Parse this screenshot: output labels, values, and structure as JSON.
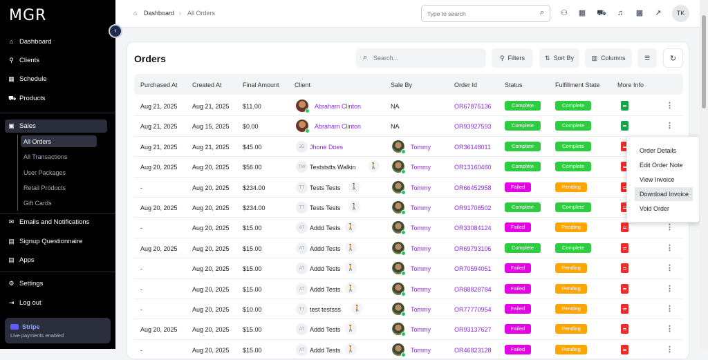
{
  "sidebar": {
    "logo": "MGR",
    "items": [
      {
        "label": "Dashboard",
        "icon": "home-icon"
      },
      {
        "label": "Clients",
        "icon": "user-icon"
      },
      {
        "label": "Schedule",
        "icon": "calendar-icon"
      },
      {
        "label": "Products",
        "icon": "cart-icon"
      },
      {
        "label": "Sales",
        "icon": "box-icon"
      },
      {
        "label": "Emails and Notifications",
        "icon": "mail-icon"
      },
      {
        "label": "Signup Questionnaire",
        "icon": "book-icon"
      },
      {
        "label": "Apps",
        "icon": "book-icon"
      },
      {
        "label": "Settings",
        "icon": "gear-icon"
      },
      {
        "label": "Log out",
        "icon": "logout-icon"
      }
    ],
    "sales_sub": [
      "All Orders",
      "All Transactions",
      "User Packages",
      "Retail Products",
      "Gift Cards"
    ],
    "stripe": {
      "title": "Stripe",
      "subtitle": "Live payments enabled"
    }
  },
  "header": {
    "breadcrumb_home": "Dashboard",
    "breadcrumb_current": "All Orders",
    "search_placeholder": "Type to search",
    "avatar": "TK"
  },
  "orders": {
    "title": "Orders",
    "search_placeholder": "Search...",
    "filters_label": "Filters",
    "sort_label": "Sort By",
    "columns_label": "Columns",
    "headers": [
      "Purchased At",
      "Created At",
      "Final Amount",
      "Client",
      "Sale By",
      "Order Id",
      "Status",
      "Fulfillment State",
      "More Info"
    ],
    "rows": [
      {
        "purchased": "Aug 21, 2025",
        "created": "Aug 21, 2025",
        "amount": "$11.00",
        "client": "Abraham Clinton",
        "client_type": "photo",
        "sale_by": "NA",
        "order_id": "OR67875136",
        "status": "Complete",
        "fulfill": "Complete",
        "doc": "green"
      },
      {
        "purchased": "Aug 21, 2025",
        "created": "Aug 15, 2025",
        "amount": "$0.00",
        "client": "Abraham Clinton",
        "client_type": "photo",
        "sale_by": "NA",
        "order_id": "OR93927593",
        "status": "Complete",
        "fulfill": "Complete",
        "doc": "green"
      },
      {
        "purchased": "Aug 21, 2025",
        "created": "Aug 21, 2025",
        "amount": "$45.00",
        "client": "Jhone Does",
        "client_type": "initials",
        "initials": "JD",
        "sale_by": "Tommy",
        "order_id": "OR36148011",
        "status": "Complete",
        "fulfill": "Complete",
        "doc": "red"
      },
      {
        "purchased": "Aug 20, 2025",
        "created": "Aug 20, 2025",
        "amount": "$56.00",
        "client": "Testststts Walkin",
        "client_type": "initials",
        "initials": "TW",
        "walkin": true,
        "sale_by": "Tommy",
        "order_id": "OR13160460",
        "status": "Complete",
        "fulfill": "Complete",
        "doc": "red"
      },
      {
        "purchased": "-",
        "created": "Aug 20, 2025",
        "amount": "$234.00",
        "client": "Tests Tests",
        "client_type": "initials",
        "initials": "TT",
        "walkin": true,
        "sale_by": "Tommy",
        "order_id": "OR66452958",
        "status": "Failed",
        "fulfill": "Pending",
        "doc": "red"
      },
      {
        "purchased": "Aug 20, 2025",
        "created": "Aug 20, 2025",
        "amount": "$234.00",
        "client": "Tests Tests",
        "client_type": "initials",
        "initials": "TT",
        "walkin": true,
        "sale_by": "Tommy",
        "order_id": "OR91706502",
        "status": "Complete",
        "fulfill": "Complete",
        "doc": "red"
      },
      {
        "purchased": "-",
        "created": "Aug 20, 2025",
        "amount": "$15.00",
        "client": "Addd Tests",
        "client_type": "initials",
        "initials": "AT",
        "walkin": true,
        "sale_by": "Tommy",
        "order_id": "OR33084124",
        "status": "Failed",
        "fulfill": "Pending",
        "doc": "red"
      },
      {
        "purchased": "Aug 20, 2025",
        "created": "Aug 20, 2025",
        "amount": "$15.00",
        "client": "Addd Tests",
        "client_type": "initials",
        "initials": "AT",
        "walkin": true,
        "sale_by": "Tommy",
        "order_id": "OR69793106",
        "status": "Complete",
        "fulfill": "Complete",
        "doc": "red"
      },
      {
        "purchased": "-",
        "created": "Aug 20, 2025",
        "amount": "$15.00",
        "client": "Addd Tests",
        "client_type": "initials",
        "initials": "AT",
        "walkin": true,
        "sale_by": "Tommy",
        "order_id": "OR70594051",
        "status": "Failed",
        "fulfill": "Pending",
        "doc": "red"
      },
      {
        "purchased": "-",
        "created": "Aug 20, 2025",
        "amount": "$15.00",
        "client": "Addd Tests",
        "client_type": "initials",
        "initials": "AT",
        "walkin": true,
        "sale_by": "Tommy",
        "order_id": "OR88828784",
        "status": "Failed",
        "fulfill": "Pending",
        "doc": "red"
      },
      {
        "purchased": "-",
        "created": "Aug 20, 2025",
        "amount": "$10.00",
        "client": "test testsss",
        "client_type": "initials",
        "initials": "TT",
        "walkin": true,
        "sale_by": "Tommy",
        "order_id": "OR77770954",
        "status": "Failed",
        "fulfill": "Pending",
        "doc": "red"
      },
      {
        "purchased": "Aug 20, 2025",
        "created": "Aug 20, 2025",
        "amount": "$15.00",
        "client": "Addd Tests",
        "client_type": "initials",
        "initials": "AT",
        "walkin": true,
        "sale_by": "Tommy",
        "order_id": "OR93137627",
        "status": "Failed",
        "fulfill": "Pending",
        "doc": "red"
      },
      {
        "purchased": "-",
        "created": "Aug 20, 2025",
        "amount": "$15.00",
        "client": "Addd Tests",
        "client_type": "initials",
        "initials": "AT",
        "walkin": true,
        "sale_by": "Tommy",
        "order_id": "OR46823128",
        "status": "Failed",
        "fulfill": "Pending",
        "doc": "red"
      }
    ]
  },
  "context_menu": {
    "items": [
      "Order Details",
      "Edit Order Note",
      "View Invoice",
      "Download Invoice",
      "Void Order"
    ],
    "highlighted": "Download Invoice"
  },
  "colors": {
    "complete": "#2ecc40",
    "failed": "#e600e6",
    "pending": "#ffa500",
    "link": "#8a2be2",
    "doc_green": "#16a34a",
    "doc_red": "#ef2a2a"
  }
}
